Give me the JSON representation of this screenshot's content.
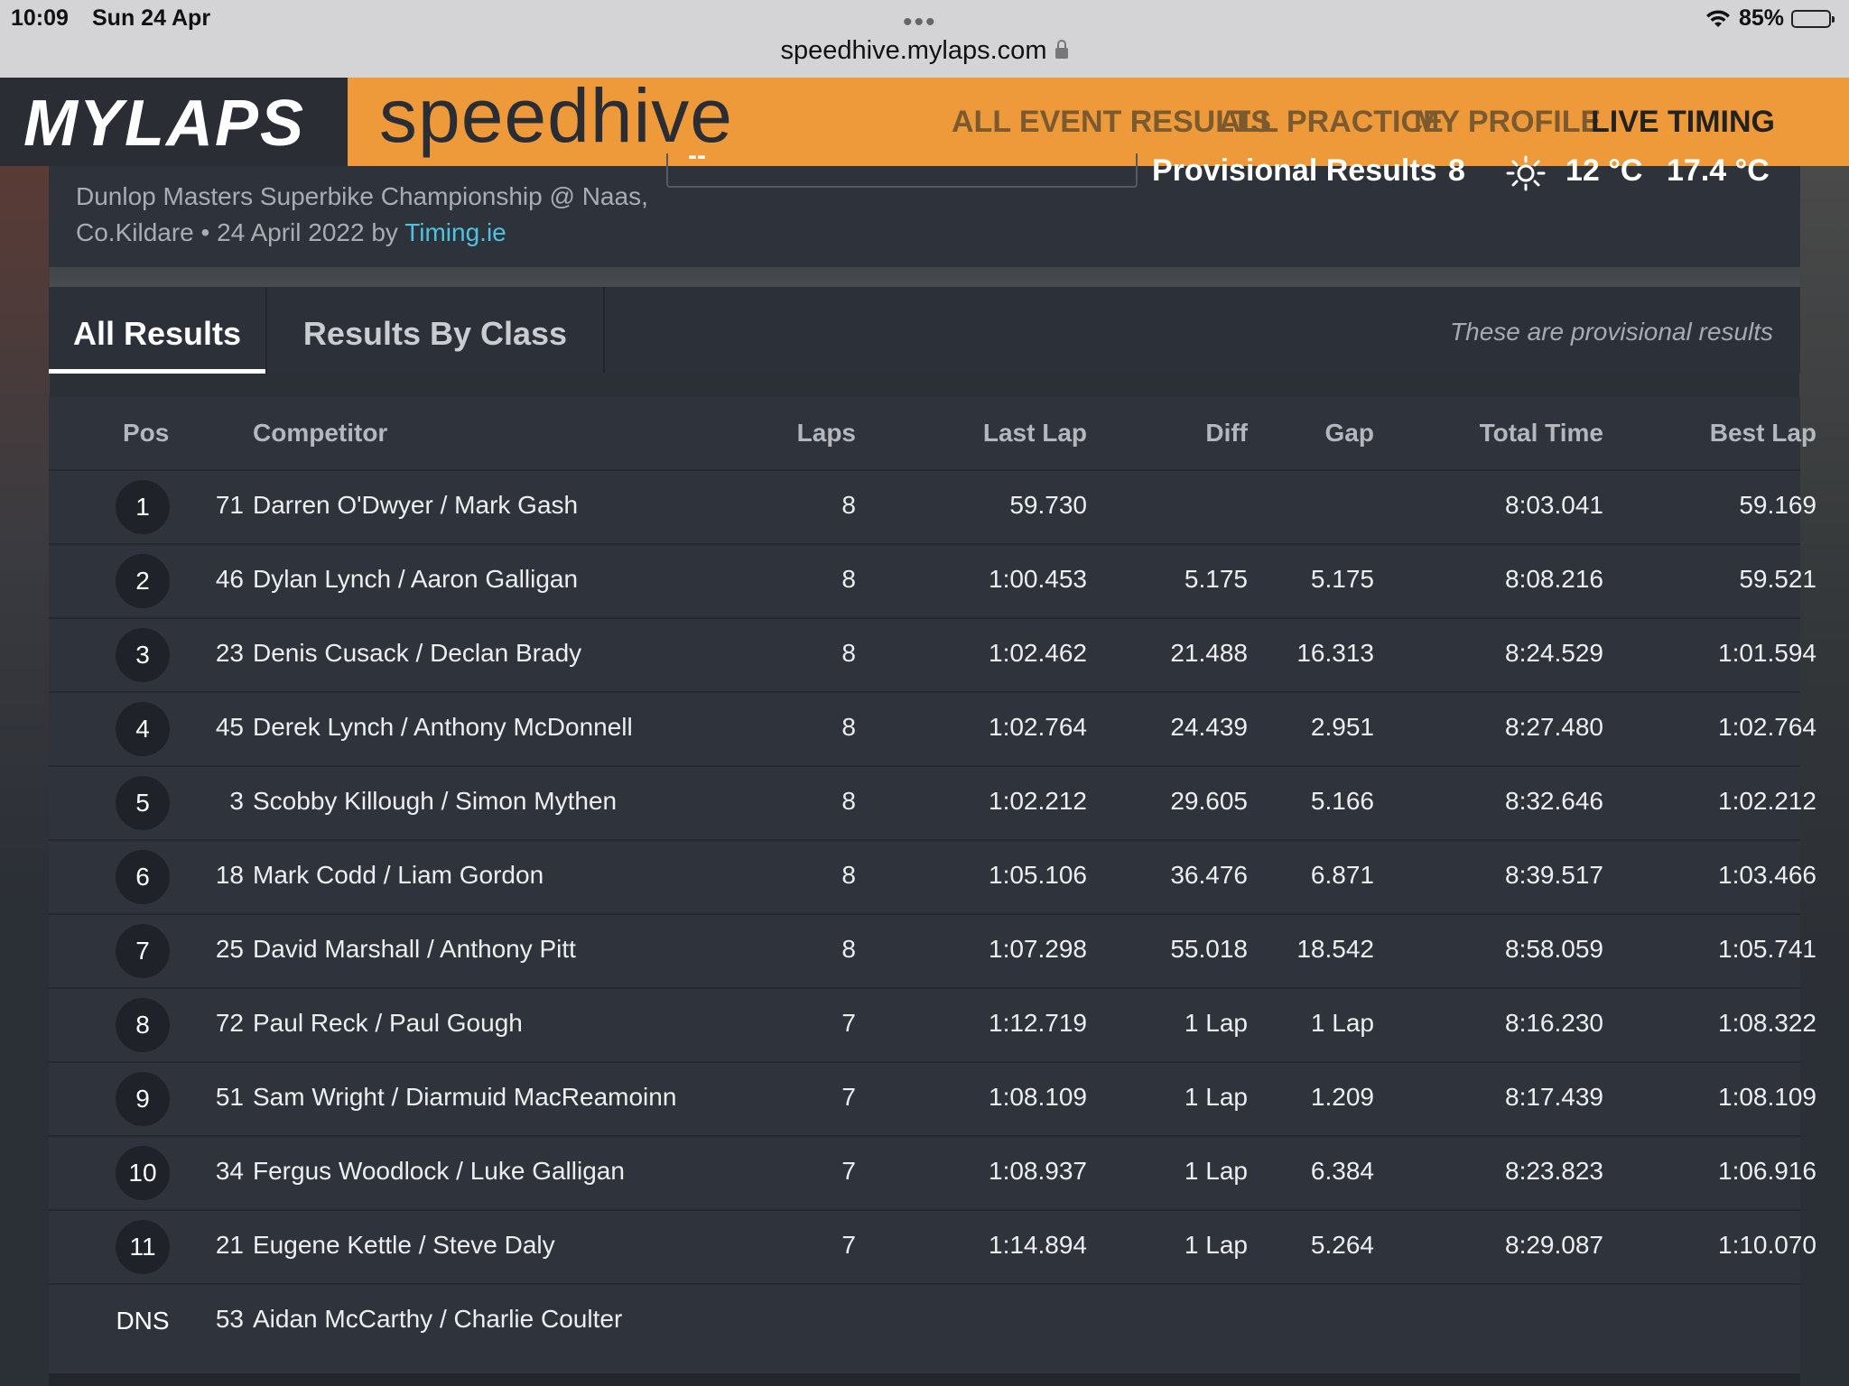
{
  "status": {
    "time": "10:09",
    "date": "Sun 24 Apr",
    "url": "speedhive.mylaps.com",
    "battery": "85%",
    "battery_level": 0.85
  },
  "header": {
    "logo": "MYLAPS",
    "brand": "speedhive",
    "nav": [
      "ALL EVENT RESULTS",
      "ALL PRACTICE",
      "MY PROFILE",
      "LIVE TIMING"
    ]
  },
  "event": {
    "subtitle_line1": "Dunlop Masters Superbike Championship @ Naas,",
    "subtitle_line2": "Co.Kildare • 24 April 2022 by ",
    "timing_link": "Timing.ie",
    "search_value": "--",
    "session_status": "Provisional Results",
    "laps": "8",
    "air_temp": "12 °C",
    "track_temp": "17.4 °C"
  },
  "tabs": {
    "all": "All Results",
    "by_class": "Results By Class",
    "note": "These are provisional results"
  },
  "table": {
    "headers": {
      "pos": "Pos",
      "competitor": "Competitor",
      "laps": "Laps",
      "last_lap": "Last Lap",
      "diff": "Diff",
      "gap": "Gap",
      "total": "Total Time",
      "best": "Best Lap"
    },
    "rows": [
      {
        "pos": "1",
        "num": "71",
        "name": "Darren O'Dwyer / Mark Gash",
        "laps": "8",
        "last": "59.730",
        "diff": "",
        "gap": "",
        "total": "8:03.041",
        "best": "59.169"
      },
      {
        "pos": "2",
        "num": "46",
        "name": "Dylan Lynch / Aaron Galligan",
        "laps": "8",
        "last": "1:00.453",
        "diff": "5.175",
        "gap": "5.175",
        "total": "8:08.216",
        "best": "59.521"
      },
      {
        "pos": "3",
        "num": "23",
        "name": "Denis Cusack / Declan Brady",
        "laps": "8",
        "last": "1:02.462",
        "diff": "21.488",
        "gap": "16.313",
        "total": "8:24.529",
        "best": "1:01.594"
      },
      {
        "pos": "4",
        "num": "45",
        "name": "Derek Lynch / Anthony McDonnell",
        "laps": "8",
        "last": "1:02.764",
        "diff": "24.439",
        "gap": "2.951",
        "total": "8:27.480",
        "best": "1:02.764"
      },
      {
        "pos": "5",
        "num": "3",
        "name": "Scobby Killough / Simon Mythen",
        "laps": "8",
        "last": "1:02.212",
        "diff": "29.605",
        "gap": "5.166",
        "total": "8:32.646",
        "best": "1:02.212"
      },
      {
        "pos": "6",
        "num": "18",
        "name": "Mark Codd / Liam Gordon",
        "laps": "8",
        "last": "1:05.106",
        "diff": "36.476",
        "gap": "6.871",
        "total": "8:39.517",
        "best": "1:03.466"
      },
      {
        "pos": "7",
        "num": "25",
        "name": "David Marshall / Anthony Pitt",
        "laps": "8",
        "last": "1:07.298",
        "diff": "55.018",
        "gap": "18.542",
        "total": "8:58.059",
        "best": "1:05.741"
      },
      {
        "pos": "8",
        "num": "72",
        "name": "Paul Reck / Paul Gough",
        "laps": "7",
        "last": "1:12.719",
        "diff": "1 Lap",
        "gap": "1 Lap",
        "total": "8:16.230",
        "best": "1:08.322"
      },
      {
        "pos": "9",
        "num": "51",
        "name": "Sam Wright / Diarmuid MacReamoinn",
        "laps": "7",
        "last": "1:08.109",
        "diff": "1 Lap",
        "gap": "1.209",
        "total": "8:17.439",
        "best": "1:08.109"
      },
      {
        "pos": "10",
        "num": "34",
        "name": "Fergus Woodlock / Luke Galligan",
        "laps": "7",
        "last": "1:08.937",
        "diff": "1 Lap",
        "gap": "6.384",
        "total": "8:23.823",
        "best": "1:06.916"
      },
      {
        "pos": "11",
        "num": "21",
        "name": "Eugene Kettle / Steve Daly",
        "laps": "7",
        "last": "1:14.894",
        "diff": "1 Lap",
        "gap": "5.264",
        "total": "8:29.087",
        "best": "1:10.070"
      },
      {
        "pos": "DNS",
        "num": "53",
        "name": "Aidan McCarthy / Charlie Coulter",
        "laps": "",
        "last": "",
        "diff": "",
        "gap": "",
        "total": "",
        "best": ""
      }
    ]
  },
  "colors": {
    "accent": "#ee9a3a",
    "link": "#4ec3e0",
    "background": "#2b2f36"
  }
}
